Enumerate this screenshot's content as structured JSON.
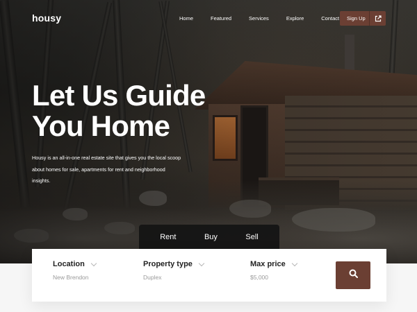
{
  "brand": {
    "logo": "housy"
  },
  "nav": {
    "items": [
      "Home",
      "Featured",
      "Services",
      "Explore",
      "Contact"
    ],
    "signup_label": "Sign Up"
  },
  "hero": {
    "headline_line1": "Let Us Guide",
    "headline_line2": "You Home",
    "description": "Housy is an all-in-one real estate site that gives you the local scoop about homes for sale, apartments for rent and neighborhood insights."
  },
  "tabs": [
    "Rent",
    "Buy",
    "Sell"
  ],
  "search": {
    "fields": [
      {
        "title": "Location",
        "value": "New Brendon"
      },
      {
        "title": "Property type",
        "value": "Duplex"
      },
      {
        "title": "Max price",
        "value": "$5,000"
      }
    ]
  },
  "colors": {
    "accent": "#6b3f33",
    "tab_bg": "#141414"
  },
  "icons": {
    "signup": "external-link-icon",
    "search": "search-icon",
    "dropdown": "chevron-down-icon"
  }
}
